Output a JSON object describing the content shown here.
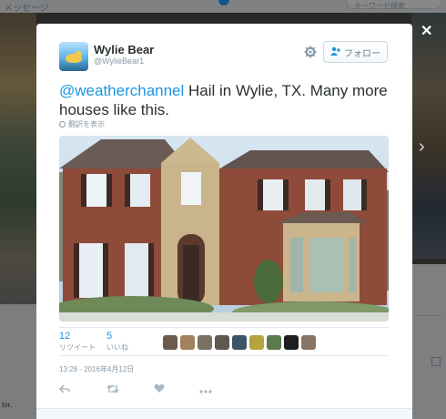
{
  "background": {
    "top_left_text": "メッセージ",
    "search_placeholder": "キーワード検索",
    "bottom_text": "tor."
  },
  "controls": {
    "close_glyph": "✕",
    "next_glyph": "›"
  },
  "tweet": {
    "display_name": "Wylie Bear",
    "screen_name": "@WylieBear1",
    "follow_label": "フォロー",
    "mention": "@weatherchannel",
    "text": " Hail in Wylie, TX. Many more houses like this.",
    "translate_label": "翻訳を表示",
    "retweets": {
      "count": "12",
      "label": "リツイート"
    },
    "likes": {
      "count": "5",
      "label": "いいね"
    },
    "liker_faces": [
      "face-1",
      "face-2",
      "face-3",
      "face-4",
      "face-5",
      "face-6",
      "face-7",
      "face-8",
      "face-9"
    ],
    "timestamp": "13:28 - 2016年4月12日"
  },
  "icons": {
    "gear": "gear-icon",
    "follow": "add-user-icon",
    "reply": "reply-icon",
    "retweet": "retweet-icon",
    "like": "heart-icon",
    "more": "more-icon"
  },
  "colors": {
    "link": "#1b95e0",
    "text": "#292f33",
    "muted": "#8899a6"
  }
}
